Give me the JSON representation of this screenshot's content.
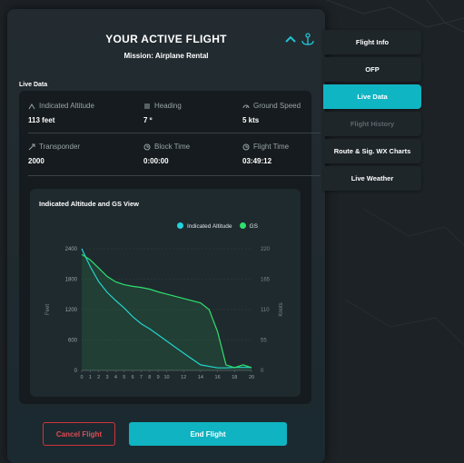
{
  "header": {
    "title": "YOUR ACTIVE FLIGHT",
    "mission": "Mission: Airplane Rental"
  },
  "section_label": "Live Data",
  "metrics": [
    {
      "label": "Indicated Altitude",
      "value": "113 feet",
      "icon": "altitude-icon"
    },
    {
      "label": "Heading",
      "value": "7 º",
      "icon": "heading-icon"
    },
    {
      "label": "Ground Speed",
      "value": "5 kts",
      "icon": "speedometer-icon"
    },
    {
      "label": "Transponder",
      "value": "2000",
      "icon": "transponder-icon"
    },
    {
      "label": "Block Time",
      "value": "0:00:00",
      "icon": "clock-icon"
    },
    {
      "label": "Flight Time",
      "value": "03:49:12",
      "icon": "clock-icon"
    }
  ],
  "chart_card_title": "Indicated Altitude and GS View",
  "chart_data": {
    "type": "area",
    "title": "Indicated Altitude and GS View",
    "xlabel": "",
    "ylabel": "Feet",
    "y2label": "Knots",
    "x": [
      0,
      1,
      2,
      3,
      4,
      5,
      6,
      7,
      8,
      9,
      10,
      12,
      14,
      16,
      18,
      20
    ],
    "x_ticks": [
      "0",
      "1",
      "2",
      "3",
      "4",
      "5",
      "6",
      "7",
      "8",
      "9",
      "10",
      "12",
      "14",
      "16",
      "18",
      "20"
    ],
    "y_ticks": [
      "0",
      "600",
      "1200",
      "1800",
      "2400"
    ],
    "y2_ticks": [
      "0",
      "55",
      "110",
      "165",
      "220"
    ],
    "ylim": [
      0,
      2400
    ],
    "y2lim": [
      0,
      220
    ],
    "series": [
      {
        "name": "Indicated Altitude",
        "color": "#22d3dc",
        "axis": "left",
        "x": [
          0,
          1,
          2,
          3,
          4,
          5,
          6,
          7,
          8,
          9,
          10,
          12,
          14,
          16,
          17,
          18,
          19,
          20
        ],
        "values": [
          2400,
          2050,
          1750,
          1540,
          1380,
          1230,
          1060,
          920,
          820,
          700,
          580,
          340,
          110,
          50,
          50,
          60,
          60,
          60
        ]
      },
      {
        "name": "GS",
        "color": "#2ee06e",
        "axis": "right",
        "x": [
          0,
          1,
          2,
          3,
          4,
          5,
          6,
          7,
          8,
          9,
          10,
          12,
          14,
          15,
          16,
          17,
          18,
          19,
          20
        ],
        "values": [
          210,
          200,
          185,
          170,
          160,
          155,
          152,
          150,
          147,
          142,
          138,
          130,
          122,
          110,
          70,
          10,
          5,
          10,
          5
        ]
      }
    ],
    "grid": true,
    "legend": "top-right"
  },
  "buttons": {
    "cancel": "Cancel Flight",
    "end": "End Flight"
  },
  "nav": [
    {
      "label": "Flight Info",
      "state": "normal"
    },
    {
      "label": "OFP",
      "state": "normal"
    },
    {
      "label": "Live Data",
      "state": "active"
    },
    {
      "label": "Flight History",
      "state": "disabled"
    },
    {
      "label": "Route & Sig. WX Charts",
      "state": "normal"
    },
    {
      "label": "Live Weather",
      "state": "normal"
    }
  ],
  "colors": {
    "accent": "#10b5c4",
    "danger": "#d0343b",
    "altitude_line": "#22d3dc",
    "gs_line": "#2ee06e"
  }
}
